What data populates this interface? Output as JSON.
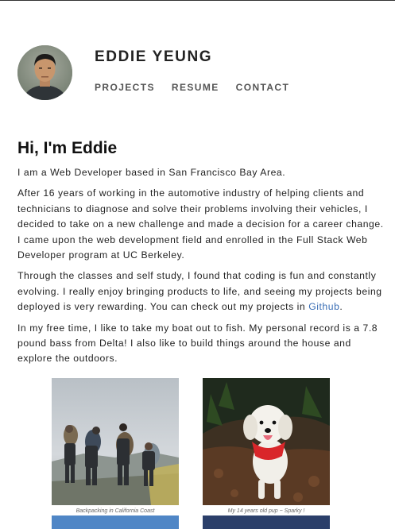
{
  "header": {
    "name": "EDDIE YEUNG",
    "nav": [
      {
        "label": "PROJECTS"
      },
      {
        "label": "RESUME"
      },
      {
        "label": "CONTACT"
      }
    ]
  },
  "main": {
    "heading": "Hi, I'm Eddie",
    "para1": "I am a Web Developer based in San Francisco Bay Area.",
    "para2": "After 16 years of working in the automotive industry of helping clients and technicians to diagnose and solve their problems involving their vehicles, I decided to take on a new challenge and made a decision for a career change. I came upon the web development field and enrolled in the Full Stack Web Developer program at UC Berkeley.",
    "para3_before_link": "Through the classes and self study, I found that coding is fun and constantly evolving. I really enjoy bringing products to life, and seeing my projects being deployed is very rewarding. You can check out my projects in ",
    "para3_link": "Github",
    "para3_after_link": ".",
    "para4": "In my free time, I like to take my boat out to fish. My personal record is a 7.8 pound bass from Delta! I also like to build things around the house and explore the outdoors."
  },
  "gallery": {
    "items": [
      {
        "caption": "Backpacking in California Coast"
      },
      {
        "caption": "My 14 years old pup ~ Sparky !"
      }
    ]
  },
  "colors": {
    "link": "#3a6eb5",
    "text": "#222222",
    "nav": "#555555"
  }
}
